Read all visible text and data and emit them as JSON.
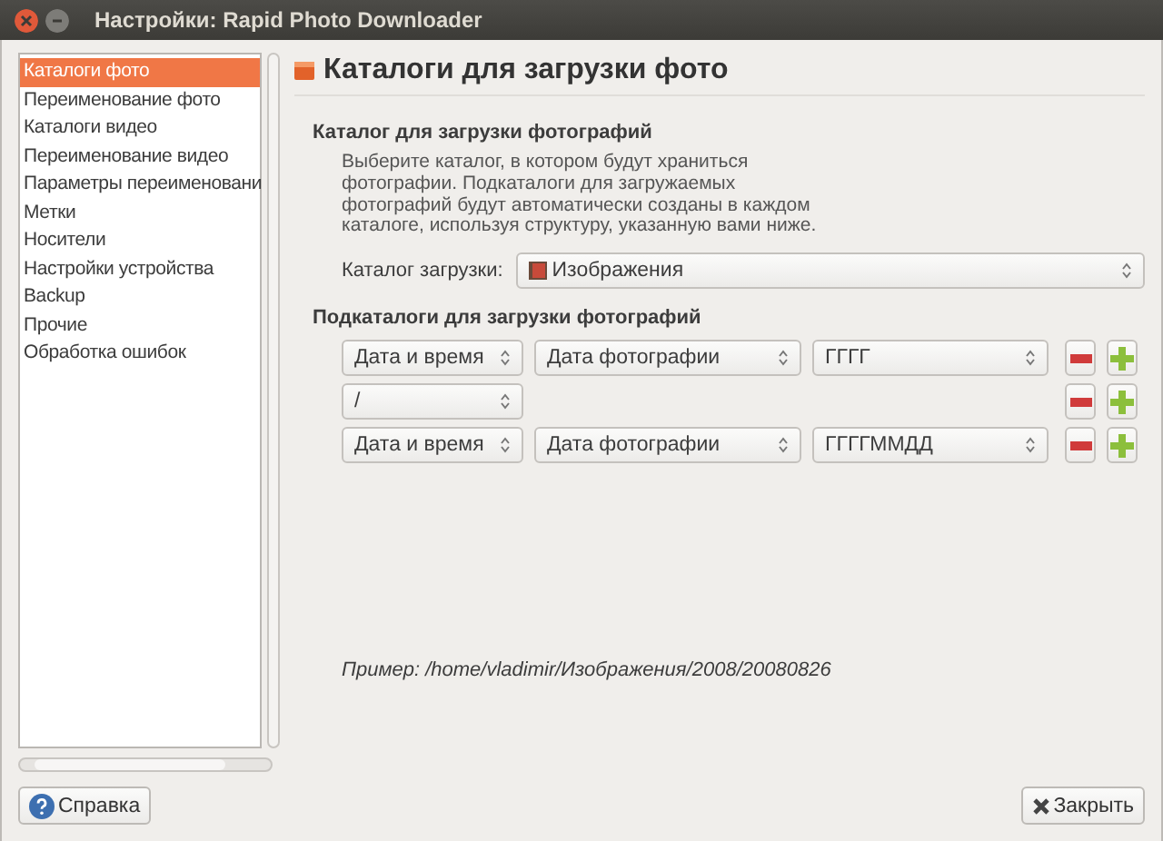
{
  "window": {
    "title": "Настройки: Rapid Photo Downloader"
  },
  "sidebar": {
    "items": [
      {
        "label": "Каталоги фото",
        "selected": true
      },
      {
        "label": "Переименование фото",
        "selected": false
      },
      {
        "label": "Каталоги видео",
        "selected": false
      },
      {
        "label": "Переименование видео",
        "selected": false
      },
      {
        "label": "Параметры переименовани",
        "selected": false
      },
      {
        "label": "Метки",
        "selected": false
      },
      {
        "label": "Носители",
        "selected": false
      },
      {
        "label": "Настройки устройства",
        "selected": false
      },
      {
        "label": "Backup",
        "selected": false
      },
      {
        "label": "Прочие",
        "selected": false
      },
      {
        "label": "Обработка ошибок",
        "selected": false
      }
    ]
  },
  "page": {
    "title": "Каталоги для загрузки фото",
    "section": "Каталог для загрузки фотографий",
    "description": "Выберите каталог, в котором будут храниться фотографии. Подкаталоги для загружаемых фотографий будут автоматически созданы в каждом каталоге, используя структуру, указанную вами ниже.",
    "folder_label": "Каталог загрузки:",
    "folder_value": "Изображения",
    "subfolders_heading": "Подкаталоги для загрузки фотографий",
    "subfolder_rows": [
      [
        "Дата и время",
        "Дата фотографии",
        "ГГГГ"
      ],
      [
        "/"
      ],
      [
        "Дата и время",
        "Дата фотографии",
        "ГГГГММДД"
      ]
    ],
    "example": "Пример: /home/vladimir/Изображения/2008/20080826"
  },
  "buttons": {
    "help": "Справка",
    "close": "Закрыть"
  }
}
